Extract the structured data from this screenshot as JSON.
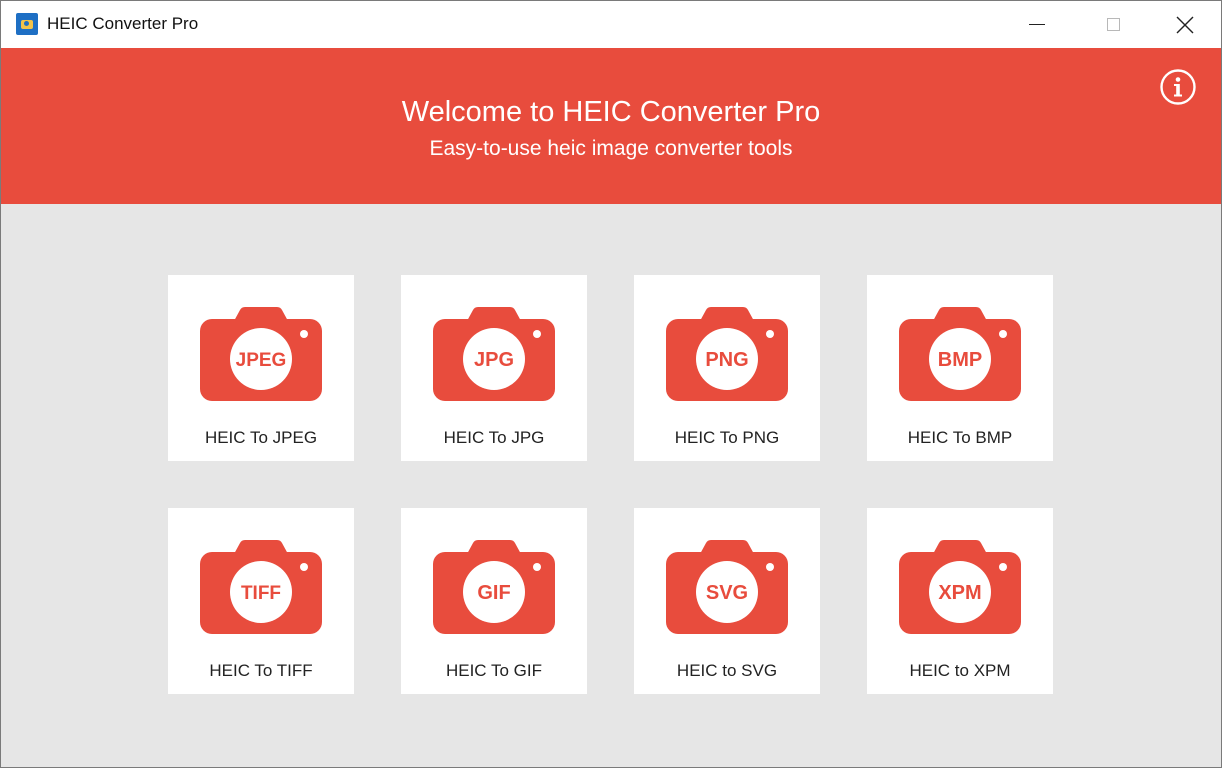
{
  "window": {
    "title": "HEIC Converter Pro",
    "app_icon": "picture-icon"
  },
  "banner": {
    "title": "Welcome to HEIC Converter Pro",
    "subtitle": "Easy-to-use heic image converter tools",
    "info_icon": "info-icon",
    "background_color": "#e84c3d"
  },
  "colors": {
    "accent": "#e84c3d",
    "tile_background": "#ffffff",
    "canvas_background": "#e6e6e6"
  },
  "tiles": [
    {
      "badge": "JPEG",
      "label": "HEIC To JPEG"
    },
    {
      "badge": "JPG",
      "label": "HEIC To JPG"
    },
    {
      "badge": "PNG",
      "label": "HEIC To PNG"
    },
    {
      "badge": "BMP",
      "label": "HEIC To BMP"
    },
    {
      "badge": "TIFF",
      "label": "HEIC To TIFF"
    },
    {
      "badge": "GIF",
      "label": "HEIC To GIF"
    },
    {
      "badge": "SVG",
      "label": "HEIC to SVG"
    },
    {
      "badge": "XPM",
      "label": "HEIC to XPM"
    }
  ]
}
